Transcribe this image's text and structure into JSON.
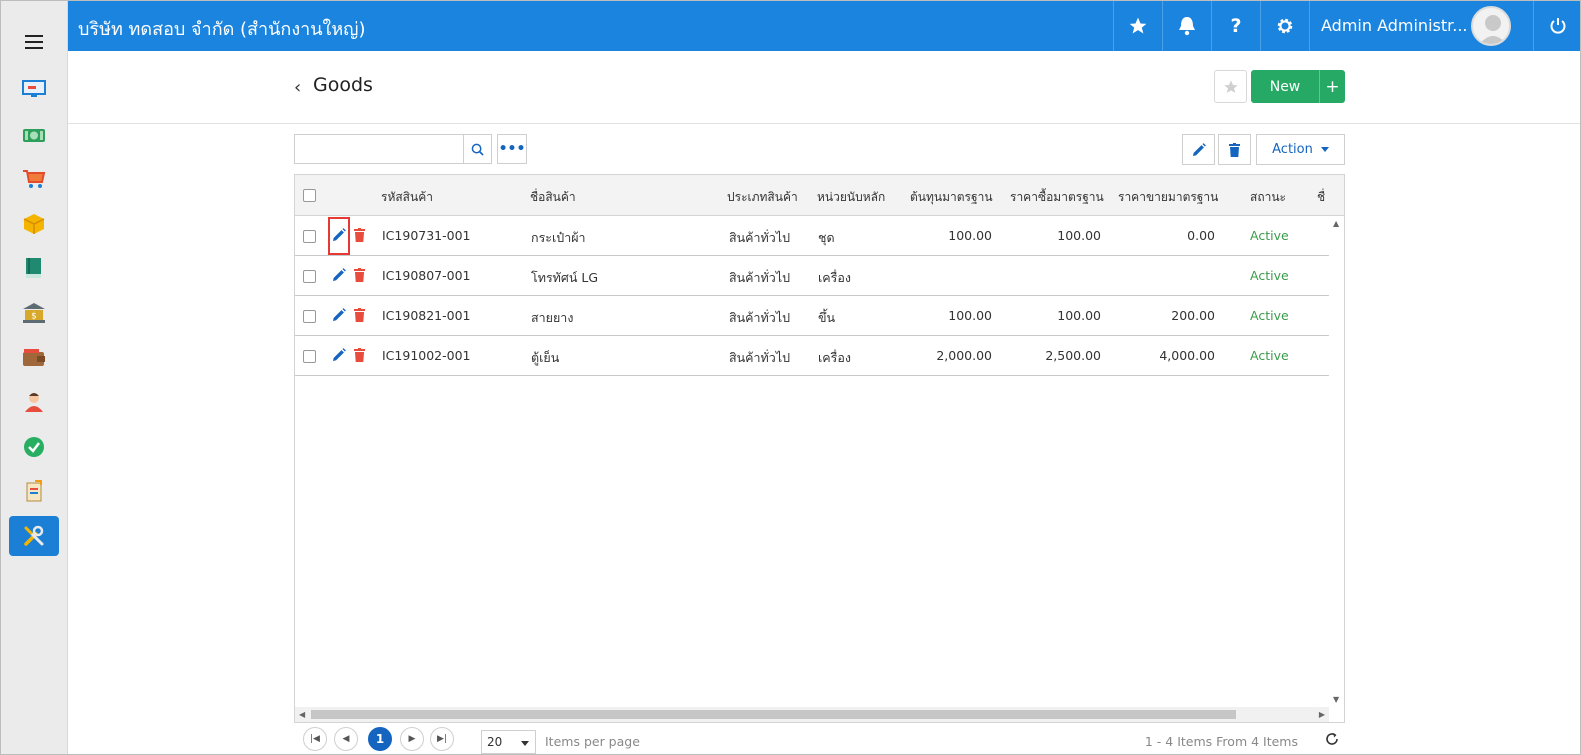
{
  "topbar": {
    "company": "บริษัท ทดสอบ จำกัด (สำนักงานใหญ่)",
    "user_name": "Admin Administr...",
    "icons": [
      "star-icon",
      "bell-icon",
      "help-icon",
      "gear-icon",
      "power-icon"
    ],
    "help_label": "?"
  },
  "sidebar": {
    "items": [
      {
        "name": "dashboard-icon"
      },
      {
        "name": "cash-icon"
      },
      {
        "name": "cart-icon"
      },
      {
        "name": "box-icon"
      },
      {
        "name": "book-icon"
      },
      {
        "name": "bank-icon"
      },
      {
        "name": "wallet-icon"
      },
      {
        "name": "people-icon"
      },
      {
        "name": "check-icon"
      },
      {
        "name": "document-icon"
      },
      {
        "name": "tools-icon",
        "active": true
      }
    ]
  },
  "page": {
    "title": "Goods",
    "back_chevron": "‹",
    "new_label": "New",
    "new_plus": "+"
  },
  "toolbar": {
    "search_value": "",
    "more_label": "•••",
    "action_label": "Action"
  },
  "table": {
    "headers": {
      "code": "รหัสสินค้า",
      "name": "ชื่อสินค้า",
      "type": "ประเภทสินค้า",
      "unit": "หน่วยนับหลัก",
      "std_cost": "ต้นทุนมาตรฐาน",
      "std_buy": "ราคาซื้อมาตรฐาน",
      "std_sell": "ราคาขายมาตรฐาน",
      "status": "สถานะ",
      "extra": "ชื่"
    },
    "rows": [
      {
        "code": "IC190731-001",
        "name": "กระเป๋าผ้า",
        "type": "สินค้าทั่วไป",
        "unit": "ชุด",
        "std_cost": "100.00",
        "std_buy": "100.00",
        "std_sell": "0.00",
        "status": "Active"
      },
      {
        "code": "IC190807-001",
        "name": "โทรทัศน์ LG",
        "type": "สินค้าทั่วไป",
        "unit": "เครื่อง",
        "std_cost": "",
        "std_buy": "",
        "std_sell": "",
        "status": "Active"
      },
      {
        "code": "IC190821-001",
        "name": "สายยาง",
        "type": "สินค้าทั่วไป",
        "unit": "ขึ้น",
        "std_cost": "100.00",
        "std_buy": "100.00",
        "std_sell": "200.00",
        "status": "Active"
      },
      {
        "code": "IC191002-001",
        "name": "ตู้เย็น",
        "type": "สินค้าทั่วไป",
        "unit": "เครื่อง",
        "std_cost": "2,000.00",
        "std_buy": "2,500.00",
        "std_sell": "4,000.00",
        "status": "Active"
      }
    ]
  },
  "pager": {
    "current_page": "1",
    "page_size": "20",
    "items_per_page_label": "Items per page",
    "info": "1 - 4 Items From 4 Items"
  },
  "colors": {
    "topbar": "#1b84de",
    "active_sidebar": "#1b7fd6",
    "new_button": "#26a965",
    "status_active": "#3a9d4a",
    "edit_icon": "#1565c0",
    "delete_icon": "#e74c3c",
    "highlight": "#e53935"
  }
}
